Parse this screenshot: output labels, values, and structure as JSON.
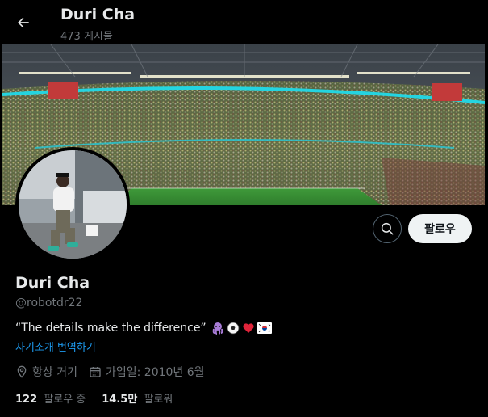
{
  "header": {
    "name": "Duri Cha",
    "post_count": "473 게시물"
  },
  "profile": {
    "display_name": "Duri Cha",
    "handle": "@robotdr22",
    "bio": "“The details make the difference”",
    "bio_emojis": [
      "octopus-emoji",
      "soccer-ball-emoji",
      "red-heart-emoji",
      "south-korea-flag-emoji"
    ],
    "translate_link": "자기소개 번역하기",
    "location": "항상 거기",
    "joined": "가입일: 2010년 6월"
  },
  "actions": {
    "follow_label": "팔로우"
  },
  "stats": {
    "following_count": "122",
    "following_label": "팔로우 중",
    "followers_count": "14.5만",
    "followers_label": "팔로워"
  },
  "colors": {
    "background": "#000000",
    "text_primary": "#e7e9ea",
    "text_secondary": "#71767b",
    "link": "#1d9bf0",
    "button_bg": "#eff3f4"
  }
}
